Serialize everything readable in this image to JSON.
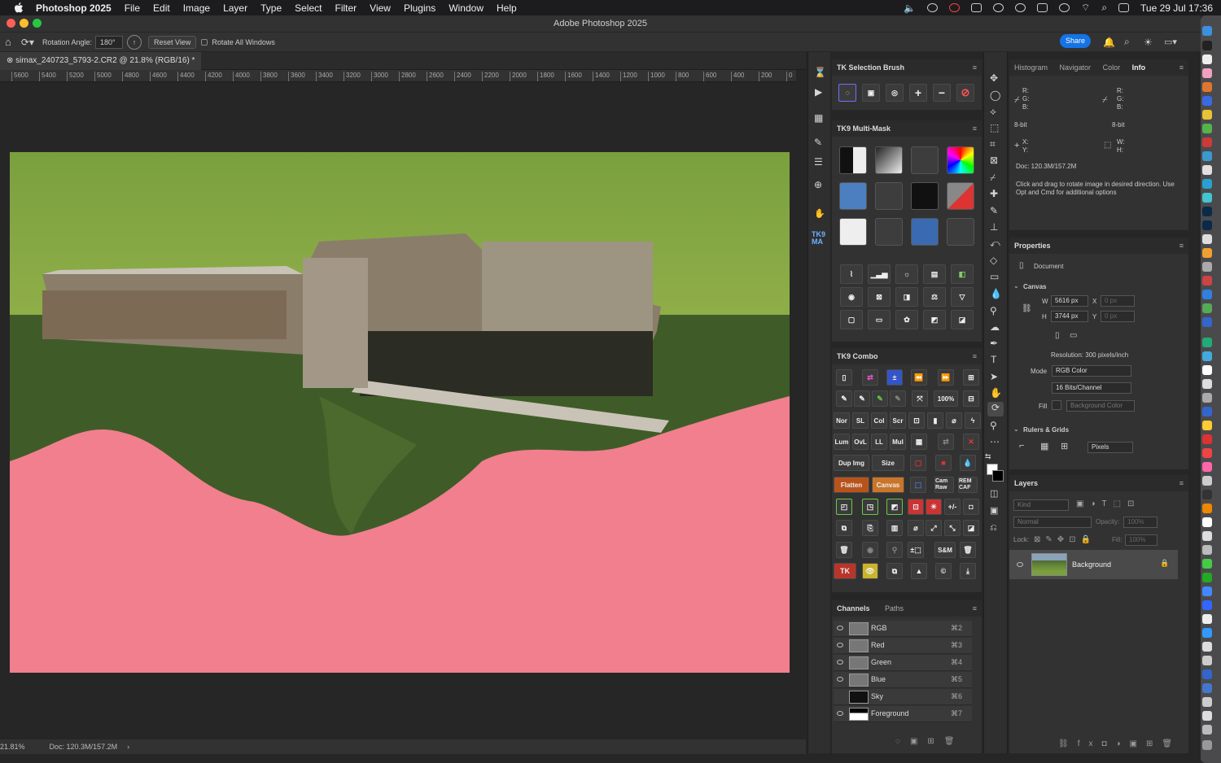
{
  "menubar": {
    "app": "Photoshop 2025",
    "items": [
      "File",
      "Edit",
      "Image",
      "Layer",
      "Type",
      "Select",
      "Filter",
      "View",
      "Plugins",
      "Window",
      "Help"
    ],
    "clock": "Tue 29 Jul  17:36"
  },
  "window": {
    "title": "Adobe Photoshop 2025"
  },
  "options": {
    "rotation_label": "Rotation Angle:",
    "rotation_value": "180°",
    "reset_view": "Reset View",
    "rotate_all": "Rotate All Windows",
    "share": "Share"
  },
  "document": {
    "tab": "simax_240723_5793-2.CR2 @ 21.8% (RGB/16) *",
    "zoom": "21.81%",
    "doc_size": "Doc: 120.3M/157.2M",
    "ruler_ticks": [
      "5600",
      "5400",
      "5200",
      "5000",
      "4800",
      "4600",
      "4400",
      "4200",
      "4000",
      "3800",
      "3600",
      "3400",
      "3200",
      "3000",
      "2800",
      "2600",
      "2400",
      "2200",
      "2000",
      "1800",
      "1600",
      "1400",
      "1200",
      "1000",
      "800",
      "600",
      "400",
      "200",
      "0"
    ]
  },
  "tk_selection": {
    "title": "TK Selection Brush"
  },
  "tk9_multimask": {
    "title": "TK9 Multi-Mask"
  },
  "tk9_combo": {
    "title": "TK9 Combo",
    "text_buttons": [
      "100%",
      "Nor",
      "SL",
      "Col",
      "Scr",
      "Lum",
      "OvL",
      "LL",
      "Mul",
      "Dup Img",
      "Size",
      "Flatten",
      "Canvas",
      "Cam Raw",
      "REM CAF",
      "S&M",
      "TK"
    ]
  },
  "channels": {
    "tabs": [
      "Channels",
      "Paths"
    ],
    "rows": [
      {
        "name": "RGB",
        "shortcut": "⌘2"
      },
      {
        "name": "Red",
        "shortcut": "⌘3"
      },
      {
        "name": "Green",
        "shortcut": "⌘4"
      },
      {
        "name": "Blue",
        "shortcut": "⌘5"
      },
      {
        "name": "Sky",
        "shortcut": "⌘6"
      },
      {
        "name": "Foreground",
        "shortcut": "⌘7"
      }
    ]
  },
  "info": {
    "tabs": [
      "Histogram",
      "Navigator",
      "Color",
      "Info"
    ],
    "rgb_labels": "R:\nG:\nB:",
    "bit_left": "8-bit",
    "bit_right": "8-bit",
    "xy": "X:\nY:",
    "wh": "W:\nH:",
    "doc": "Doc: 120.3M/157.2M",
    "hint": "Click and drag to rotate image in desired direction. Use Opt and Cmd for additional options"
  },
  "properties": {
    "title": "Properties",
    "document_label": "Document",
    "canvas_label": "Canvas",
    "w_label": "W",
    "w_value": "5616 px",
    "h_label": "H",
    "h_value": "3744 px",
    "x_label": "X",
    "x_value": "0 px",
    "y_label": "Y",
    "y_value": "0 px",
    "resolution": "Resolution: 300 pixels/inch",
    "mode_label": "Mode",
    "mode_value": "RGB Color",
    "bits_value": "16 Bits/Channel",
    "fill_label": "Fill",
    "fill_value": "Background Color",
    "rulers_label": "Rulers & Grids",
    "units_value": "Pixels"
  },
  "layers": {
    "title": "Layers",
    "kind": "Kind",
    "blend": "Normal",
    "opacity_label": "Opacity:",
    "opacity_value": "100%",
    "lock_label": "Lock:",
    "fill_label": "Fill:",
    "fill_value": "100%",
    "layer_name": "Background"
  }
}
